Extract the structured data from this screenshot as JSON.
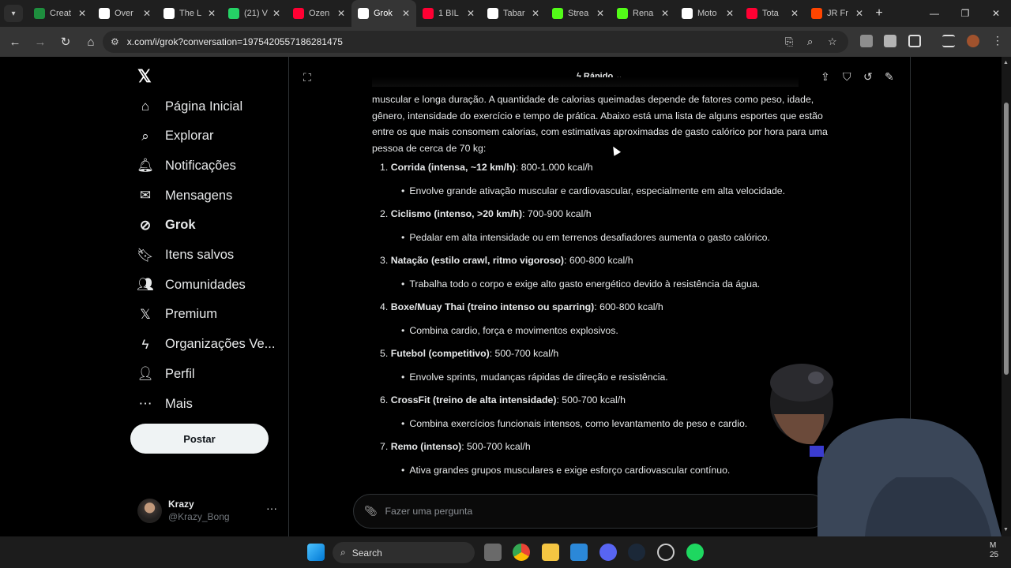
{
  "browser": {
    "tabs": [
      {
        "title": "Creat",
        "icon": "sheets-icon",
        "color": "#1e8e3e",
        "active": false
      },
      {
        "title": "Over",
        "icon": "google-icon",
        "color": "#ffffff",
        "active": false
      },
      {
        "title": "The L",
        "icon": "shield-icon",
        "color": "#ffffff",
        "active": false
      },
      {
        "title": "(21) V",
        "icon": "whatsapp-icon",
        "color": "#25d366",
        "active": false
      },
      {
        "title": "Ozen",
        "icon": "youtube-icon",
        "color": "#ff0033",
        "active": false
      },
      {
        "title": "Grok",
        "icon": "x-icon",
        "color": "#ffffff",
        "active": true
      },
      {
        "title": "1 BIL",
        "icon": "youtube-icon",
        "color": "#ff0033",
        "active": false
      },
      {
        "title": "Tabar",
        "icon": "x-icon",
        "color": "#ffffff",
        "active": false
      },
      {
        "title": "Strea",
        "icon": "kick-icon",
        "color": "#53fc18",
        "active": false
      },
      {
        "title": "Rena",
        "icon": "kick-icon",
        "color": "#53fc18",
        "active": false
      },
      {
        "title": "Moto",
        "icon": "x-icon",
        "color": "#ffffff",
        "active": false
      },
      {
        "title": "Tota",
        "icon": "youtube-icon",
        "color": "#ff0033",
        "active": false
      },
      {
        "title": "JR Fr",
        "icon": "reddit-icon",
        "color": "#ff4500",
        "active": false
      }
    ],
    "url": "x.com/i/grok?conversation=1975420557186281475"
  },
  "sidebar": {
    "items": [
      {
        "label": "Página Inicial",
        "icon": "home-icon",
        "glyph": "⌂",
        "name": "sidebar-item-home"
      },
      {
        "label": "Explorar",
        "icon": "search-icon",
        "glyph": "⌕",
        "name": "sidebar-item-explore"
      },
      {
        "label": "Notificações",
        "icon": "bell-icon",
        "glyph": "🔔︎",
        "name": "sidebar-item-notifications"
      },
      {
        "label": "Mensagens",
        "icon": "mail-icon",
        "glyph": "✉",
        "name": "sidebar-item-messages"
      },
      {
        "label": "Grok",
        "icon": "grok-icon",
        "glyph": "⊘",
        "name": "sidebar-item-grok"
      },
      {
        "label": "Itens salvos",
        "icon": "bookmark-icon",
        "glyph": "🔖︎",
        "name": "sidebar-item-bookmarks"
      },
      {
        "label": "Comunidades",
        "icon": "communities-icon",
        "glyph": "👥︎",
        "name": "sidebar-item-communities"
      },
      {
        "label": "Premium",
        "icon": "x-icon",
        "glyph": "𝕏",
        "name": "sidebar-item-premium"
      },
      {
        "label": "Organizações Ve...",
        "icon": "lightning-icon",
        "glyph": "ϟ",
        "name": "sidebar-item-organizations"
      },
      {
        "label": "Perfil",
        "icon": "person-icon",
        "glyph": "👤︎",
        "name": "sidebar-item-profile"
      },
      {
        "label": "Mais",
        "icon": "more-circle-icon",
        "glyph": "⋯",
        "name": "sidebar-item-more"
      }
    ],
    "post_label": "Postar",
    "user": {
      "name": "Krazy",
      "handle": "@Krazy_Bong"
    }
  },
  "grok": {
    "mode_label": "Rápido",
    "intro": "muscular e longa duração. A quantidade de calorias queimadas depende de fatores como peso, idade, gênero, intensidade do exercício e tempo de prática. Abaixo está uma lista de alguns esportes que estão entre os que mais consomem calorias, com estimativas aproximadas de gasto calórico por hora para uma pessoa de cerca de 70 kg:",
    "items": [
      {
        "num": "1.",
        "name": "Corrida (intensa, ~12 km/h)",
        "value": ": 800-1.000 kcal/h",
        "detail": "Envolve grande ativação muscular e cardiovascular, especialmente em alta velocidade."
      },
      {
        "num": "2.",
        "name": "Ciclismo (intenso, >20 km/h)",
        "value": ": 700-900 kcal/h",
        "detail": "Pedalar em alta intensidade ou em terrenos desafiadores aumenta o gasto calórico."
      },
      {
        "num": "3.",
        "name": "Natação (estilo crawl, ritmo vigoroso)",
        "value": ": 600-800 kcal/h",
        "detail": "Trabalha todo o corpo e exige alto gasto energético devido à resistência da água."
      },
      {
        "num": "4.",
        "name": "Boxe/Muay Thai (treino intenso ou sparring)",
        "value": ": 600-800 kcal/h",
        "detail": "Combina cardio, força e movimentos explosivos."
      },
      {
        "num": "5.",
        "name": "Futebol (competitivo)",
        "value": ": 500-700 kcal/h",
        "detail": "Envolve sprints, mudanças rápidas de direção e resistência."
      },
      {
        "num": "6.",
        "name": "CrossFit (treino de alta intensidade)",
        "value": ": 500-700 kcal/h",
        "detail": "Combina exercícios funcionais intensos, como levantamento de peso e cardio."
      },
      {
        "num": "7.",
        "name": "Remo (intenso)",
        "value": ": 500-700 kcal/h",
        "detail": "Ativa grandes grupos musculares e exige esforço cardiovascular contínuo."
      }
    ],
    "ask_placeholder": "Fazer uma pergunta"
  },
  "taskbar": {
    "search_label": "Search",
    "clock": "M\n25"
  }
}
